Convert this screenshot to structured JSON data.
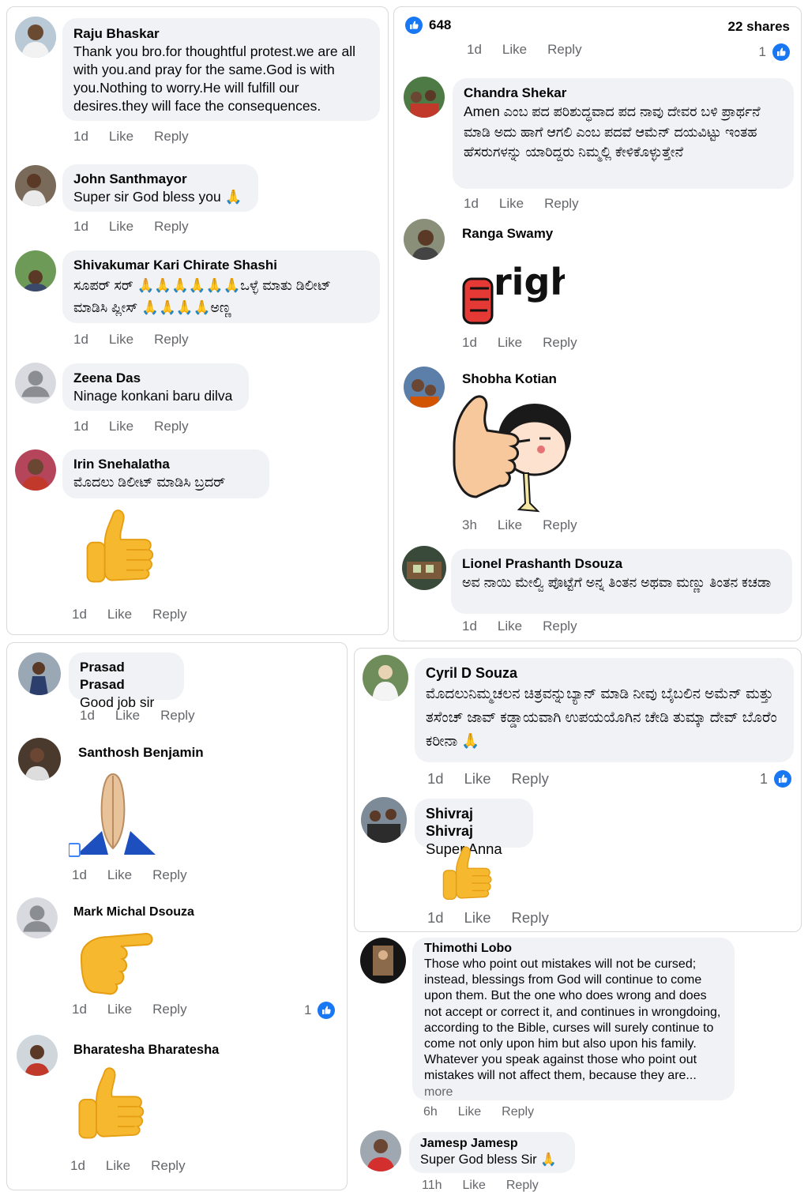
{
  "actions": {
    "like": "Like",
    "reply": "Reply"
  },
  "panel1": {
    "comments": [
      {
        "name": "Raju Bhaskar",
        "text": "Thank you bro.for thoughtful protest.we are all with you.and pray for the same.God is with you.Nothing to worry.He will fulfill our desires.they will face the consequences.",
        "time": "1d"
      },
      {
        "name": "John Santhmayor",
        "text": "Super sir God bless you 🙏",
        "time": "1d"
      },
      {
        "name": "Shivakumar Kari Chirate Shashi",
        "text": "ಸೂಪರ್ ಸರ್ 🙏🙏🙏🙏🙏🙏ಒಳ್ಳೆ ಮಾತು ಡಿಲೀಟ್ ಮಾಡಿಸಿ ಪ್ಲೀಸ್ 🙏🙏🙏🙏ಅಣ್ಣ",
        "time": "1d"
      },
      {
        "name": "Zeena Das",
        "text": "Ninage konkani baru dilva",
        "time": "1d"
      },
      {
        "name": "Irin Snehalatha",
        "text": "ಮೊದಲು ಡಿಲೀಟ್ ಮಾಡಿಸಿ ಬ್ರದರ್",
        "time": "1d"
      }
    ]
  },
  "panel2": {
    "header": {
      "like_count": "648",
      "shares": "22 shares",
      "time": "1d",
      "reaction_count": "1"
    },
    "comments": [
      {
        "name": "Chandra Shekar",
        "text": "Amen ಎಂಬ ಪದ ಪರಿಶುದ್ಧವಾದ ಪದ ನಾವು ದೇವರ ಬಳಿ ಪ್ರಾರ್ಥನೆ ಮಾಡಿ ಅದು ಹಾಗೆ ಆಗಲಿ ಎಂಬ ಪದವೆ ಆಮೆನ್ ದಯವಿಟ್ಟು ಇಂತಹ ಹೆಸರುಗಳನ್ನು ಯಾರಿದ್ದರು ನಿಮ್ಮಲ್ಲಿ ಕೇಳಿಕೊಳ್ಳುತ್ತೇನೆ",
        "time": "1d"
      },
      {
        "name": "Ranga Swamy",
        "sticker_text": "right.",
        "time": "1d"
      },
      {
        "name": "Shobha Kotian",
        "time": "3h"
      },
      {
        "name": "Lionel Prashanth Dsouza",
        "text": "ಅವ ನಾಯಿ ಮೇಲ್ವಿ ಪೊಟ್ಟೆಗೆ ಅನ್ನ ತಿಂತನ ಅಥವಾ ಮಣ್ಣು ತಿಂತನ ಕಚಡಾ",
        "time": "1d"
      }
    ]
  },
  "panel3": {
    "comments": [
      {
        "name": "Prasad Prasad",
        "text": "Good job sir",
        "time": "1d"
      },
      {
        "name": "Santhosh Benjamin",
        "time": "1d"
      },
      {
        "name": "Mark Michal Dsouza",
        "time": "1d",
        "reaction_count": "1"
      },
      {
        "name": "Bharatesha Bharatesha",
        "time": "1d"
      }
    ]
  },
  "panel4": {
    "comments": [
      {
        "name": "Cyril D Souza",
        "text": "ಮೊದಲುನಿಮ್ಮಚಲನ ಚಿತ್ರವನ್ನುಬ್ಯಾನ್ ಮಾಡಿ ನೀವು ಬೈಬಲಿನ ಅಮೆನ್ ಮತ್ತು ತಸೆಂಚ್ ಜಾವ್ ಕಡ್ಡಾಯವಾಗಿ ಉಪಯಯೊಗಿನ ಚೇಡಿ ತುಮ್ಕಾ ದೇವ್ ಬೊರೆಂ ಕರೀನಾ 🙏",
        "time": "1d",
        "reaction_count": "1"
      },
      {
        "name": "Shivraj Shivraj",
        "text": "Super Anna",
        "time": "1d"
      }
    ]
  },
  "panel5": {
    "comments": [
      {
        "name": "Thimothi Lobo",
        "text": "Those who point out mistakes will not be cursed; instead, blessings from God will continue to come upon them. But the one who does wrong and does not accept or correct it, and continues in wrongdoing, according to the Bible, curses will surely continue to come not only upon him but also upon his family. Whatever you speak against those who point out mistakes will not affect them, because they are...",
        "more": "more",
        "time": "6h"
      },
      {
        "name": "Jamesp Jamesp",
        "text": "Super God bless Sir 🙏",
        "time": "11h"
      }
    ]
  },
  "colors": {
    "bubble": "#f0f2f5",
    "meta": "#65676b",
    "like_blue": "#1877f2",
    "emoji_yellow": "#f5b82e"
  },
  "icons": [
    "thumbs-up-emoji",
    "folded-hands-emoji",
    "pointing-hand-emoji",
    "like-reaction-icon",
    "default-avatar-icon"
  ]
}
